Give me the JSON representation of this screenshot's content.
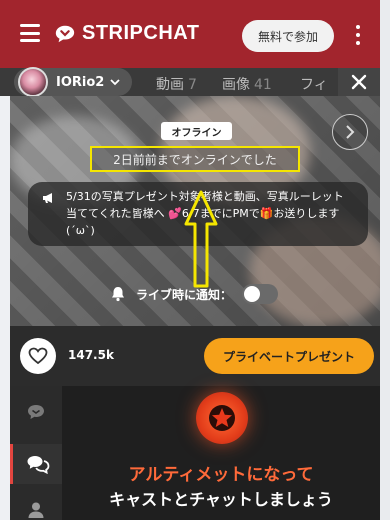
{
  "header": {
    "brand": "STRIPCHAT",
    "join_label": "無料で参加",
    "accent": "#a2252d"
  },
  "model_bar": {
    "model_name": "IORio2",
    "tabs": [
      {
        "label": "動画",
        "count": "7"
      },
      {
        "label": "画像",
        "count": "41"
      },
      {
        "label": "フィ",
        "count": ""
      }
    ]
  },
  "stage": {
    "status_badge": "オフライン",
    "last_online": "2日前前までオンラインでした",
    "announcement": "5/31の写真プレゼント対象者様と動画、写真ルーレット当ててくれた皆様へ 💕6/7までにPMで🎁お送りします(´ω`)",
    "notify_label": "ライブ時に通知：",
    "notify_enabled": false,
    "highlight_color": "#f5e600"
  },
  "actions": {
    "likes": "147.5k",
    "private_present_label": "プライベートプレゼント",
    "button_color": "#f6a21a"
  },
  "rail": {
    "icons": [
      "chat-bubble-icon",
      "chat-bubbles-icon",
      "user-icon"
    ]
  },
  "promo": {
    "line1": "アルティメットになって",
    "line2": "キャストとチャットしましょう"
  }
}
